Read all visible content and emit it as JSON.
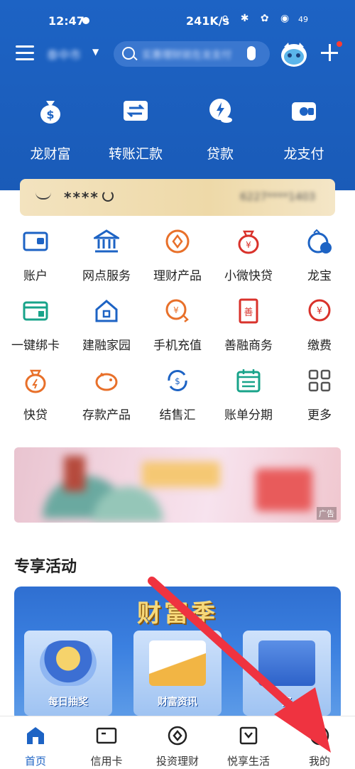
{
  "status": {
    "time": "12:47",
    "speed": "241K/s",
    "battery": "49"
  },
  "header": {
    "city": "泰中市",
    "search_placeholder": "实惠理财就在龙支付",
    "quick_actions": [
      {
        "label": "龙财富",
        "icon": "moneybag-icon"
      },
      {
        "label": "转账汇款",
        "icon": "transfer-icon"
      },
      {
        "label": "贷款",
        "icon": "loan-icon"
      },
      {
        "label": "龙支付",
        "icon": "wallet-icon"
      }
    ]
  },
  "account": {
    "masked": "****",
    "number": "6227****1403"
  },
  "grid": [
    [
      {
        "label": "账户"
      },
      {
        "label": "网点服务"
      },
      {
        "label": "理财产品"
      },
      {
        "label": "小微快贷"
      },
      {
        "label": "龙宝"
      }
    ],
    [
      {
        "label": "一键绑卡"
      },
      {
        "label": "建融家园"
      },
      {
        "label": "手机充值"
      },
      {
        "label": "善融商务"
      },
      {
        "label": "缴费"
      }
    ],
    [
      {
        "label": "快贷"
      },
      {
        "label": "存款产品"
      },
      {
        "label": "结售汇"
      },
      {
        "label": "账单分期"
      },
      {
        "label": "更多"
      }
    ]
  ],
  "ad": {
    "tag": "广告"
  },
  "activities": {
    "title": "专享活动",
    "banner_title": "财富季",
    "cards": [
      {
        "label": "每日抽奖"
      },
      {
        "label": "财富资讯"
      },
      {
        "label": "资"
      }
    ]
  },
  "bottom_nav": [
    {
      "label": "首页",
      "active": true
    },
    {
      "label": "信用卡"
    },
    {
      "label": "投资理财"
    },
    {
      "label": "悦享生活"
    },
    {
      "label": "我的"
    }
  ],
  "colors": {
    "primary": "#1d63c4",
    "orange": "#e8702a",
    "red": "#d9322b",
    "green": "#18a38a",
    "arrow": "#ef3340"
  }
}
